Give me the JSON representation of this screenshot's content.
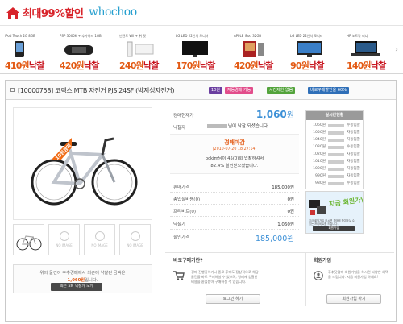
{
  "header": {
    "promo": "최대99%할인",
    "logo": "whochoo"
  },
  "strip": {
    "items": [
      {
        "name": "iPod Touch 2G 8GB",
        "price": "410원",
        "bid": "낙찰"
      },
      {
        "name": "PSP 3005K + 추가하드 1GB",
        "price": "420원",
        "bid": "낙찰"
      },
      {
        "name": "닌텐도 Wii + 위 핏",
        "price": "240원",
        "bid": "낙찰"
      },
      {
        "name": "LG LED 22인치 모니터",
        "price": "170원",
        "bid": "낙찰"
      },
      {
        "name": "APPLE iPod 32GB",
        "price": "420원",
        "bid": "낙찰"
      },
      {
        "name": "LG LED 22인치 모니터",
        "price": "90원",
        "bid": "낙찰"
      },
      {
        "name": "HP 노트북 미니",
        "price": "140원",
        "bid": "낙찰"
      }
    ]
  },
  "product": {
    "title": "[10000758] 코렉스 MTB 자전거 PJS 24SF (박지성자전거)",
    "badges": [
      {
        "label": "10원",
        "color": "#6b3fa0"
      },
      {
        "label": "자동경매 가능",
        "color": "#e24d8b"
      },
      {
        "label": "시간제한 없음",
        "color": "#53a33b"
      },
      {
        "label": "바로구매할인율 60%",
        "color": "#2f6fb8"
      }
    ],
    "ribbon": "10원경매",
    "thumbs": [
      "NO IMAGE",
      "NO IMAGE",
      "NO IMAGE"
    ],
    "note_line1": "위의 물건이 후추경매에서 최근에 낙찰된 금액은",
    "note_price": "1,060원",
    "note_suffix": "입니다.",
    "note_button": "최근 5회 낙찰가 보기"
  },
  "auction": {
    "current_label": "경매현재가",
    "current_value": "1,060",
    "current_unit": "원",
    "winner_label": "낙찰자",
    "winner_text": "님이 낙찰 되셨습니다.",
    "end_title": "경매마감",
    "end_time": "(2010-07-20 18:27:14)",
    "end_user": "bckim님이 45(0)회 입찰하셔서",
    "end_save": "82.4% 할인받으셨습니다.",
    "rows": [
      {
        "label": "판매가격",
        "value": "185,000원"
      },
      {
        "label": "총입찰비용(0)",
        "value": "0원"
      },
      {
        "label": "프리비트(0)",
        "value": "0원"
      },
      {
        "label": "낙찰가",
        "value": "1,060원"
      },
      {
        "label": "할인가격",
        "value": "185,000원"
      }
    ]
  },
  "realtime": {
    "title": "실시간현황",
    "rows": [
      {
        "price": "1060원",
        "type": "수동입찰"
      },
      {
        "price": "1050원",
        "type": "자동입찰"
      },
      {
        "price": "1040원",
        "type": "자동입찰"
      },
      {
        "price": "1030원",
        "type": "수동입찰"
      },
      {
        "price": "1020원",
        "type": "자동입찰"
      },
      {
        "price": "1010원",
        "type": "자동입찰"
      },
      {
        "price": "1000원",
        "type": "자동입찰"
      },
      {
        "price": "990원",
        "type": "자동입찰"
      },
      {
        "price": "980원",
        "type": "수동입찰"
      }
    ]
  },
  "ad": {
    "text": "지금 회원가입하면",
    "caption": "지금 회원가입 하시면 경매에 참여하실 수 있는 프리비트를 드립니다.",
    "button": "회원가입"
  },
  "direct_buy": {
    "title": "바로구매기란?",
    "text": "경매 진행중이거나 종료 후에도 정상적으로 해당 물건을 바로 구매하실 수 있으며, 경매에 입찰한 비용을 환불받아 구매하실 수 있습니다.",
    "button": "로그인 하기"
  },
  "signup": {
    "title": "회원가입",
    "text": "후추닷컴에 회원가입을 하시면 다양한 혜택을 드립니다. 지금 회원가입 하세요!",
    "button": "회원가입 하기"
  }
}
